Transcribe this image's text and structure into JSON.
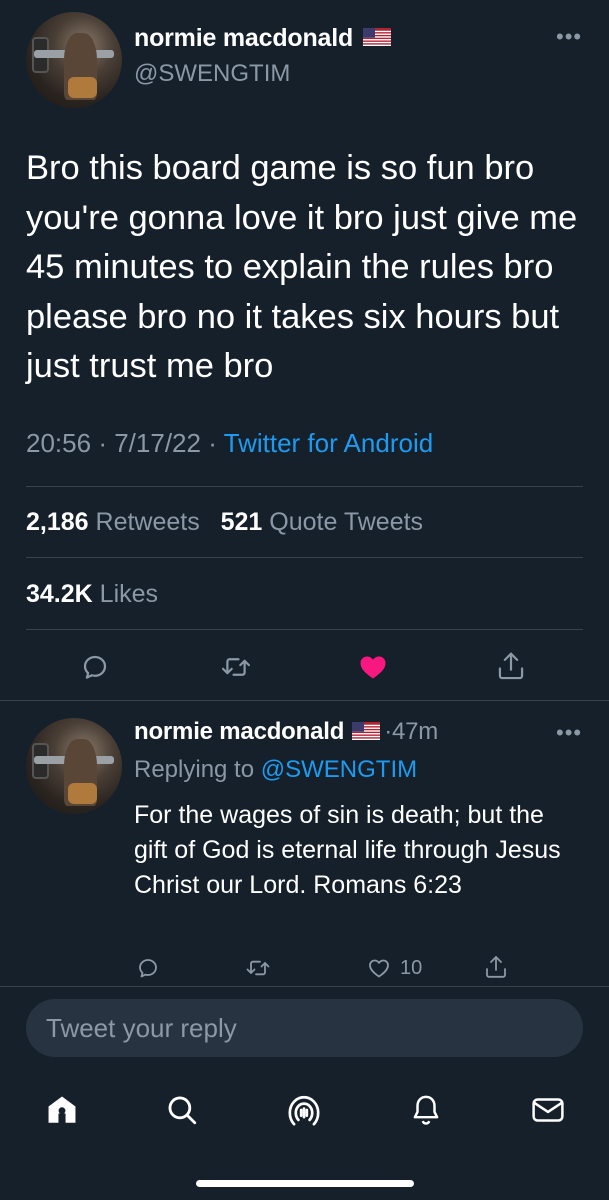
{
  "main_tweet": {
    "author_name": "normie macdonald",
    "author_handle": "@SWENGTIM",
    "flag_icon": "us-flag-icon",
    "text": "Bro this board game is so fun bro you're gonna love it bro just give me 45 minutes to explain the rules bro please bro no it takes six hours but just trust me bro",
    "time": "20:56",
    "date": "7/17/22",
    "separator": "·",
    "source": "Twitter for Android",
    "retweets_count": "2,186",
    "retweets_label": "Retweets",
    "quotes_count": "521",
    "quotes_label": "Quote Tweets",
    "likes_count": "34.2K",
    "likes_label": "Likes",
    "liked": true,
    "like_color": "#f91880"
  },
  "reply_tweet": {
    "author_name": "normie macdonald",
    "flag_icon": "us-flag-icon",
    "time_ago": "47m",
    "replying_to_label": "Replying to",
    "replying_to_handle": "@SWENGTIM",
    "text": "For the wages of sin is death; but the gift of God is eternal life through Jesus Christ our Lord. Romans 6:23",
    "like_count": "10"
  },
  "reply_input": {
    "placeholder": "Tweet your reply",
    "value": ""
  },
  "bottom_nav": {
    "items": [
      "home-icon",
      "search-icon",
      "spaces-icon",
      "notifications-icon",
      "messages-icon"
    ],
    "active": "home-icon"
  },
  "colors": {
    "background": "#15202b",
    "secondary_text": "#8b98a5",
    "accent": "#1d9bf0",
    "divider": "#38444d"
  }
}
